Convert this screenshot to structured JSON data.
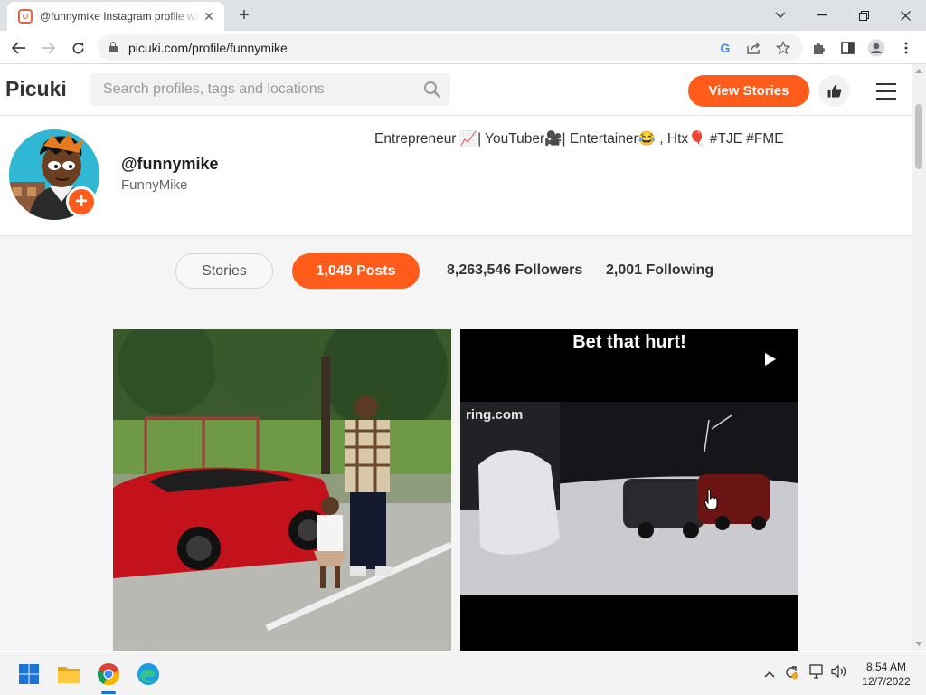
{
  "browser": {
    "tab_title": "@funnymike Instagram profile with posts and stories",
    "tab_close": "✕",
    "new_tab": "+",
    "url": "picuki.com/profile/funnymike"
  },
  "site": {
    "logo": "Picuki",
    "search_placeholder": "Search profiles, tags and locations",
    "view_stories_label": "View Stories"
  },
  "profile": {
    "username": "@funnymike",
    "full_name": "FunnyMike",
    "bio": "Entrepreneur 📈| YouTuber🎥| Entertainer😂 , Htx🎈 #TJE #FME",
    "follow_icon": "+"
  },
  "stats": {
    "stories_label": "Stories",
    "posts_label": "1,049 Posts",
    "followers_label": "8,263,546 Followers",
    "following_label": "2,001 Following"
  },
  "posts": [
    {
      "type": "photo",
      "overlay_text": ""
    },
    {
      "type": "video",
      "overlay_text": "Bet that hurt!",
      "watermark": "ring.com"
    }
  ],
  "taskbar": {
    "time": "8:54 AM",
    "date": "12/7/2022"
  },
  "colors": {
    "accent": "#ff5c1b",
    "page_bg": "#f5f5f5"
  }
}
